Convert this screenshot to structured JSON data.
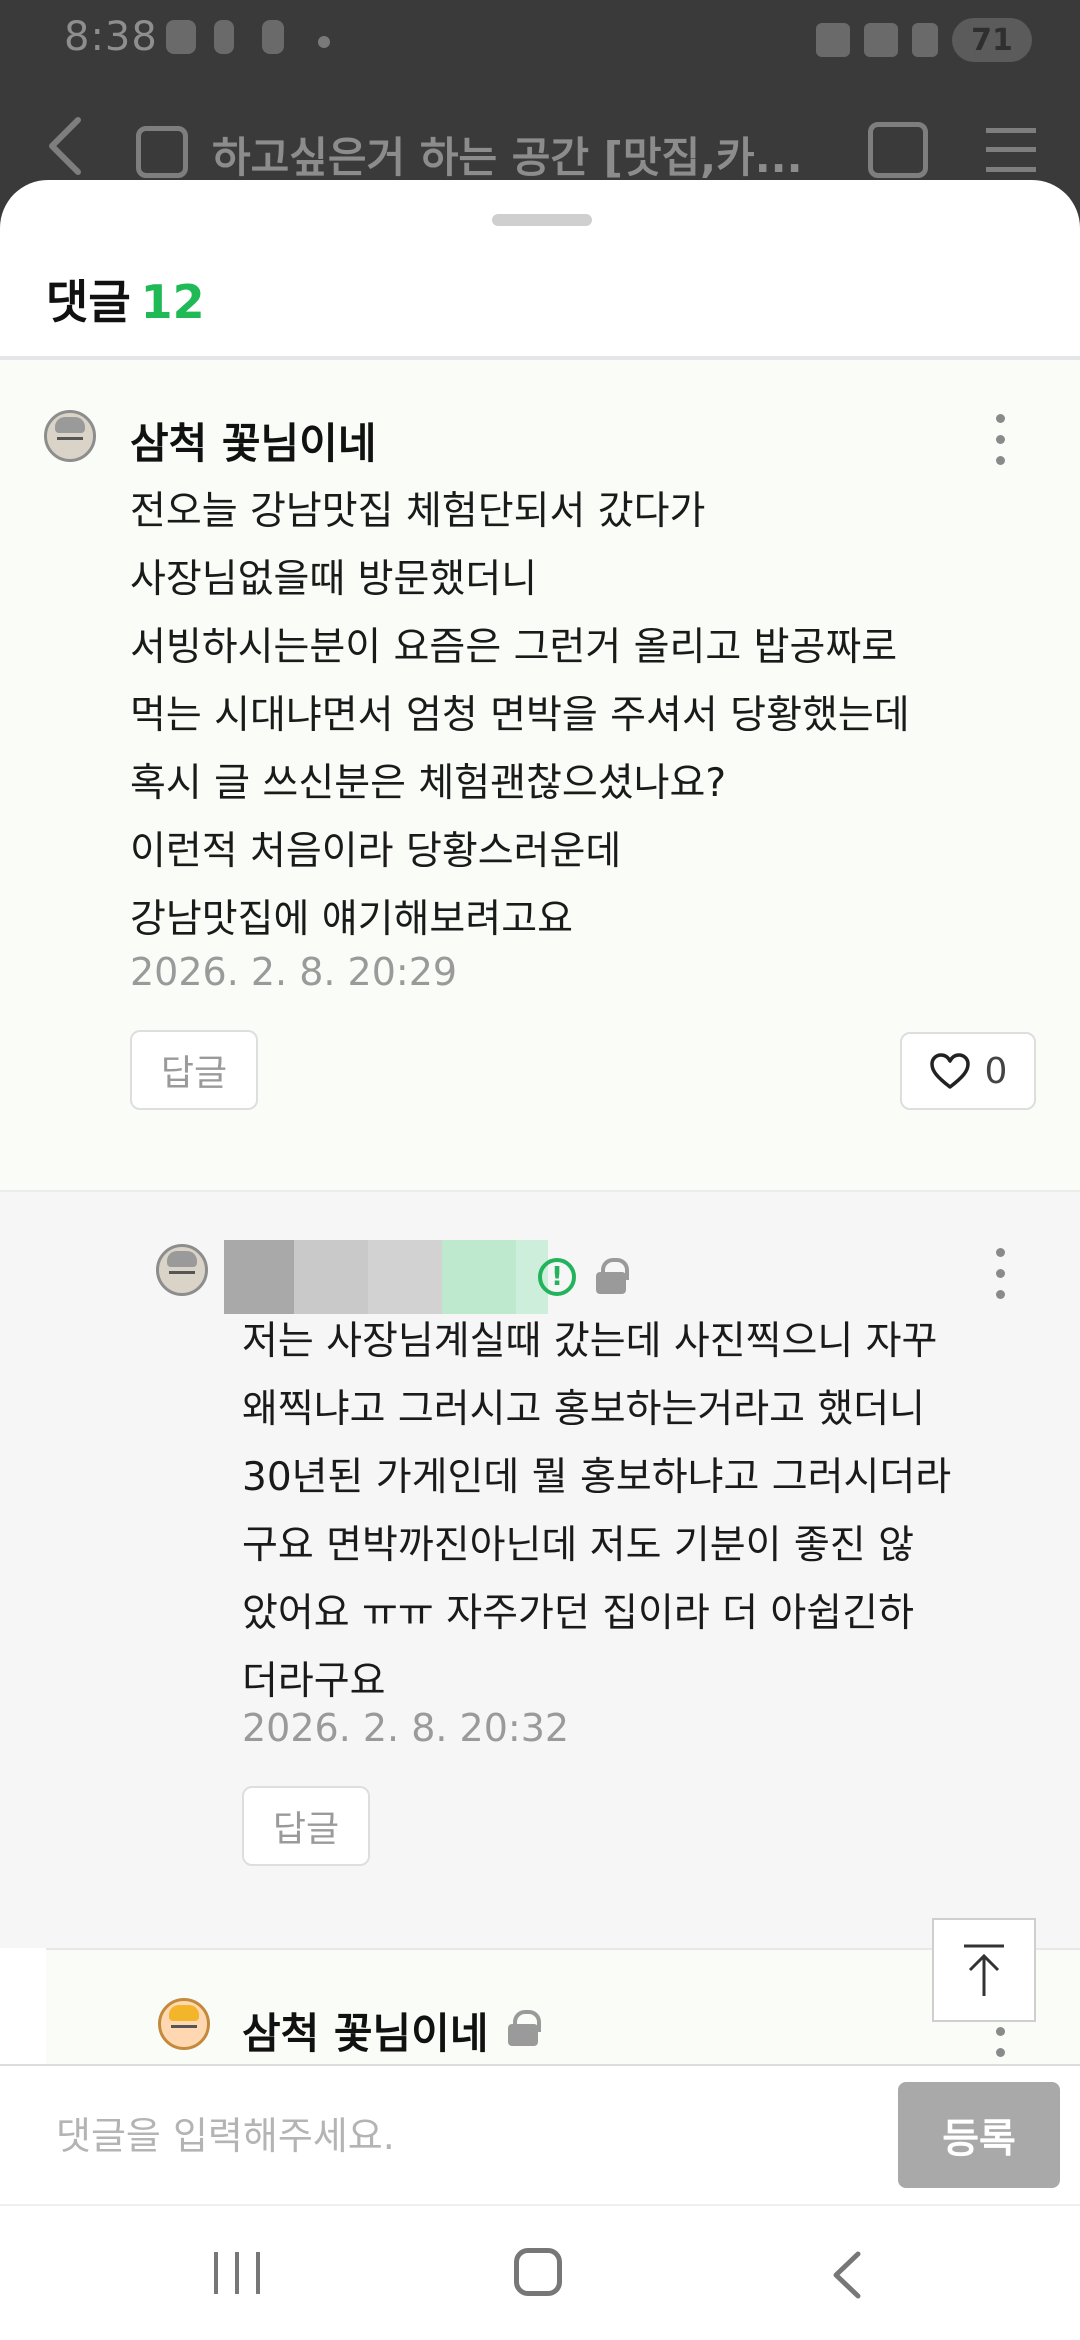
{
  "status_bar": {
    "time": "8:38",
    "battery": "71"
  },
  "header": {
    "title": "하고싶은거 하는 공간 [맛집,카..."
  },
  "sheet": {
    "title": "댓글",
    "count": "12"
  },
  "comments": [
    {
      "nickname": "삼척 꽃님이네",
      "content": "전오늘 강남맛집 체험단되서 갔다가\n사장님없을때 방문했더니\n서빙하시는분이 요즘은 그런거 올리고 밥공짜로\n먹는 시대냐면서 엄청 면박을 주셔서 당황했는데\n혹시 글 쓰신분은 체험괜찮으셨나요?\n이런적 처음이라 당황스러운데\n강남맛집에 얘기해보려고요",
      "timestamp": "2026. 2. 8. 20:29",
      "reply_label": "답글",
      "likes": "0"
    },
    {
      "nickname": "",
      "content": "저는 사장님계실때 갔는데  사진찍으니 자꾸\n왜찍냐고 그러시고 홍보하는거라고 했더니\n30년된 가게인데 뭘 홍보하냐고 그러시더라\n구요  면박까진아닌데 저도 기분이 좋진 않\n았어요  ㅠㅠ 자주가던 집이라 더 아쉽긴하\n더라구요",
      "timestamp": "2026. 2. 8. 20:32",
      "reply_label": "답글"
    },
    {
      "nickname": "삼척 꽃님이네"
    }
  ],
  "input": {
    "placeholder": "댓글을 입력해주세요.",
    "submit_label": "등록"
  },
  "colors": {
    "accent_green": "#1fb955",
    "submit_gray": "#a9a9a9"
  }
}
